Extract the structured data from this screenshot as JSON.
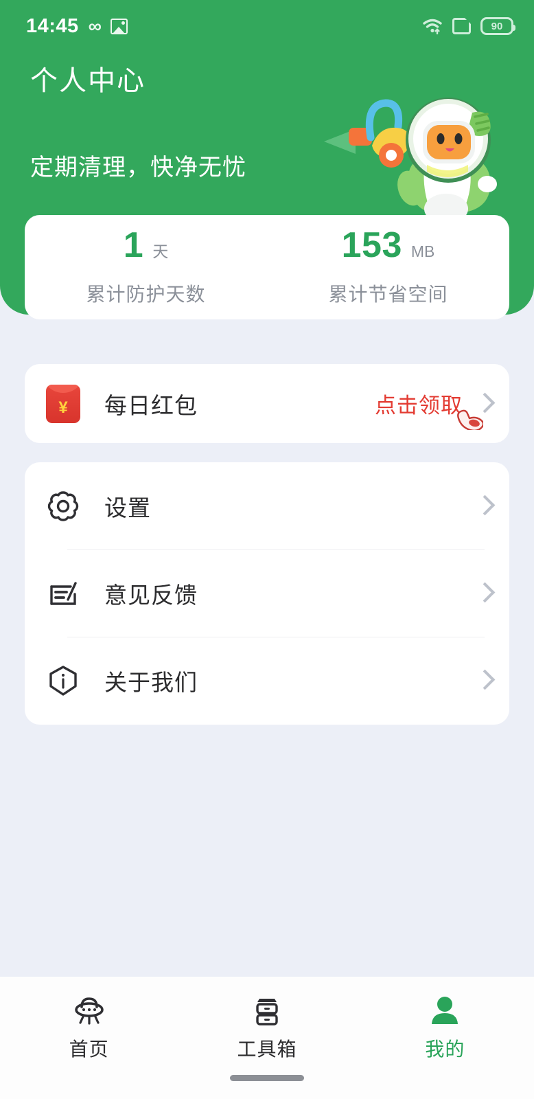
{
  "theme": {
    "brand_green": "#33a85c",
    "accent_green": "#2aa45a",
    "page_background": "#eceff7",
    "card_background": "#ffffff",
    "red_accent": "#e33b32",
    "muted_text": "#8b9099",
    "primary_text": "#2c2c2e"
  },
  "statusbar": {
    "time": "14:45",
    "left_icons": [
      "infinity-icon",
      "photo-icon"
    ],
    "right_icons": [
      "wifi-icon",
      "sim-card-icon",
      "battery-icon"
    ],
    "battery_level": "90"
  },
  "header": {
    "title": "个人中心",
    "subtitle": "定期清理，快净无忧",
    "mascot_icon": "astronaut-vacuum-mascot"
  },
  "stats": [
    {
      "value": "1",
      "unit": "天",
      "label": "累计防护天数"
    },
    {
      "value": "153",
      "unit": "MB",
      "label": "累计节省空间"
    }
  ],
  "redpacket": {
    "icon": "red-envelope-icon",
    "label": "每日红包",
    "action": "点击领取",
    "cursor_icon": "pointing-hand-icon",
    "chevron": "chevron-right-icon"
  },
  "menu": [
    {
      "icon": "gear-icon",
      "label": "设置",
      "chevron": "chevron-right-icon"
    },
    {
      "icon": "feedback-edit-icon",
      "label": "意见反馈",
      "chevron": "chevron-right-icon"
    },
    {
      "icon": "shield-info-icon",
      "label": "关于我们",
      "chevron": "chevron-right-icon"
    }
  ],
  "bottom_nav": {
    "items": [
      {
        "icon": "ufo-home-icon",
        "label": "首页",
        "active": false
      },
      {
        "icon": "toolbox-icon",
        "label": "工具箱",
        "active": false
      },
      {
        "icon": "person-icon",
        "label": "我的",
        "active": true
      }
    ]
  }
}
